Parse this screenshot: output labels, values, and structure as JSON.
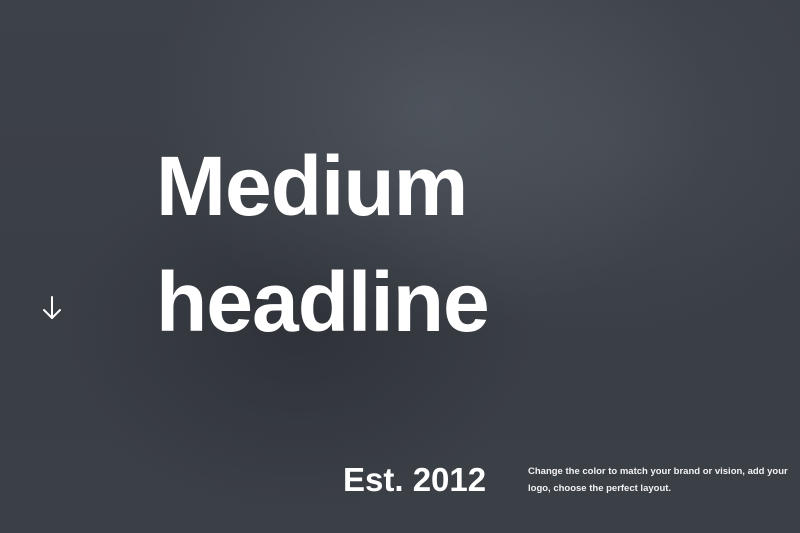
{
  "hero": {
    "headline_line1": "Medium",
    "headline_line2": "headline",
    "established": "Est. 2012",
    "description": "Change the color to match your brand or vision, add your logo, choose the perfect layout.",
    "scroll_icon": "arrow-down-icon"
  },
  "colors": {
    "background": "#3b3f46",
    "text": "#ffffff"
  }
}
